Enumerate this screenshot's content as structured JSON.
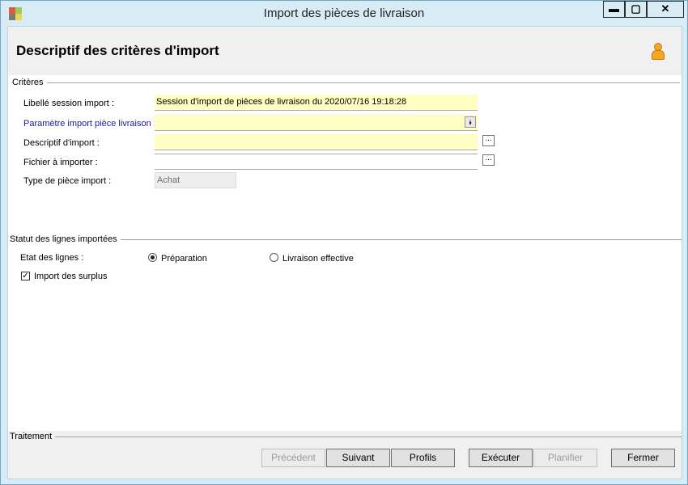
{
  "window": {
    "title": "Import des pièces de livraison",
    "controls": {
      "minimize": "▬",
      "maximize": "▢",
      "close": "✕"
    }
  },
  "header": {
    "title": "Descriptif des critères d'import",
    "icon": "user-icon"
  },
  "criteria": {
    "group_label": "Critères",
    "fields": [
      {
        "label": "Libellé session import :",
        "value": "Session d'import de pièces de livraison du 2020/07/16 19:18:28"
      },
      {
        "label": "Paramètre import pièce livraison :",
        "value": ""
      },
      {
        "label": "Descriptif d'import :",
        "value": ""
      },
      {
        "label": "Fichier à importer :",
        "value": ""
      },
      {
        "label": "Type de pièce import :",
        "value": "Achat"
      }
    ],
    "ellipsis": "..."
  },
  "status": {
    "group_label": "Statut des lignes importées",
    "etat_label": "Etat des lignes :",
    "options": [
      {
        "label": "Préparation",
        "selected": true
      },
      {
        "label": "Livraison effective",
        "selected": false
      }
    ],
    "surplus": {
      "label": "Import des surplus",
      "checked": true
    }
  },
  "footer": {
    "group_label": "Traitement",
    "buttons": [
      {
        "label": "Précédent",
        "enabled": false
      },
      {
        "label": "Suivant",
        "enabled": true
      },
      {
        "label": "Profils",
        "enabled": true
      },
      {
        "label": "Exécuter",
        "enabled": true
      },
      {
        "label": "Planifier",
        "enabled": false
      },
      {
        "label": "Fermer",
        "enabled": true
      }
    ]
  },
  "colors": {
    "accent_field": "#ffffc4",
    "titlebar": "#d8ecf6",
    "link_label": "#1a1a9e"
  }
}
